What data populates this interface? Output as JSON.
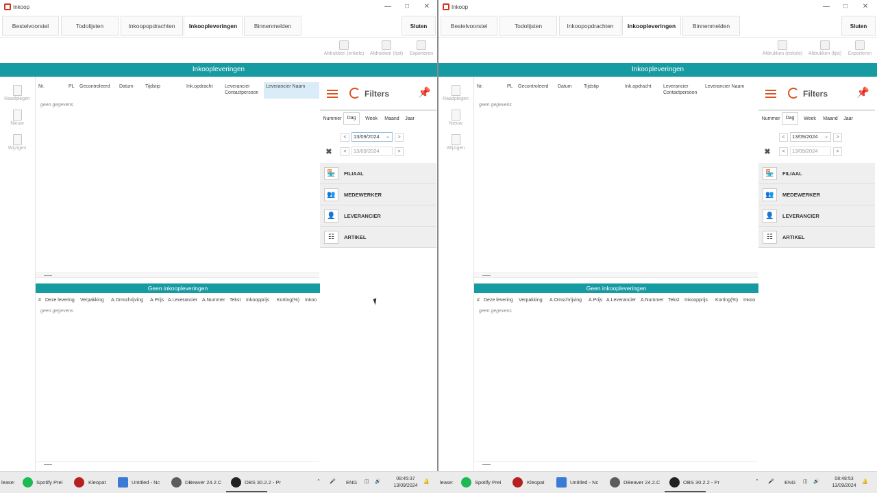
{
  "window": {
    "title": "Inkoop",
    "close_button": "Sluten"
  },
  "tabs": [
    "Bestelvoorstel",
    "Todolijsten",
    "Inkoopopdrachten",
    "Inkoopleveringen",
    "Binnenmelden"
  ],
  "toolbar": {
    "print_single": "Afdrukken (enkele)",
    "print_list": "Afdrukken (lijst)",
    "export": "Exporteren"
  },
  "banner_title": "Inkoopleveringen",
  "side_actions": {
    "view": "Raadplegen",
    "new": "Nieuw",
    "edit": "Wijzigen"
  },
  "grid": {
    "columns": [
      "Nr.",
      "PL",
      "Gecontroleerd",
      "Datum",
      "Tijdstip",
      "Ink.opdracht",
      "Leverancier Contactpersoon",
      "Leverancier Naam"
    ],
    "empty_text": "geen gegevens"
  },
  "detail": {
    "title": "Geen inkoopleveringen",
    "columns": [
      "#",
      "Deze levering",
      "Verpakking",
      "A.Omschrijving",
      "A.Prijs",
      "A.Leverancier",
      "A.Nummer",
      "Tekst",
      "Inkoopprijs",
      "Korting(%)",
      "Inkoo"
    ],
    "empty_text": "geen gegevens"
  },
  "filters": {
    "title": "Filters",
    "period_tabs": [
      "Nummer",
      "Dag",
      "Week",
      "Maand",
      "Jaar"
    ],
    "active_period": "Dag",
    "date_from": "13/09/2024",
    "date_to": "13/09/2024",
    "prev": "<",
    "next": ">",
    "groups": [
      {
        "label": "FILIAAL",
        "icon": "store-icon"
      },
      {
        "label": "MEDEWERKER",
        "icon": "people-icon"
      },
      {
        "label": "LEVERANCIER",
        "icon": "contact-card-icon"
      },
      {
        "label": "ARTIKEL",
        "icon": "barcode-icon"
      }
    ]
  },
  "taskbar": {
    "left": {
      "cut_label": "lease:",
      "apps": [
        "Spotify Prei",
        "Kleopat",
        "Untitled - Nc",
        "DBeaver 24.2.C",
        "OBS 30.2.2 - Pr"
      ],
      "lang": "ENG",
      "time": "08:45:37",
      "date": "13/09/2024"
    },
    "right": {
      "cut_label": "lease:",
      "apps": [
        "Spotify Prei",
        "Kleopat",
        "Untitled - Nc",
        "DBeaver 24.2.C",
        "OBS 30.2.2 - Pr"
      ],
      "lang": "ENG",
      "time": "08:48:53",
      "date": "13/09/2024"
    }
  },
  "colors": {
    "accent": "#169ba3",
    "filter_icons": "#d9541e"
  }
}
